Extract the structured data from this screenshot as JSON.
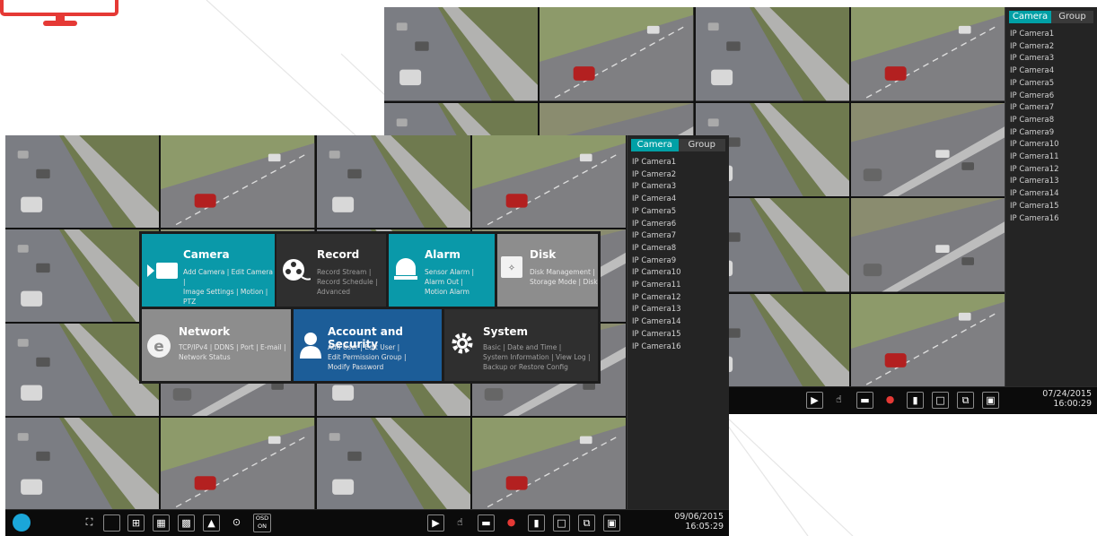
{
  "cameras": [
    "IP Camera1",
    "IP Camera2",
    "IP Camera3",
    "IP Camera4",
    "IP Camera5",
    "IP Camera6",
    "IP Camera7",
    "IP Camera8",
    "IP Camera9",
    "IP Camera10",
    "IP Camera11",
    "IP Camera12",
    "IP Camera13",
    "IP Camera14",
    "IP Camera15",
    "IP Camera16"
  ],
  "tabs": {
    "camera": "Camera",
    "group": "Group"
  },
  "back": {
    "date": "07/24/2015",
    "time": "16:00:29"
  },
  "front": {
    "date": "09/06/2015",
    "time": "16:05:29",
    "osd_line1": "OSD",
    "osd_line2": "ON"
  },
  "menu": {
    "camera": {
      "title": "Camera",
      "line1": "Add Camera | Edit Camera |",
      "line2": "Image Settings | Motion |",
      "line3": "PTZ"
    },
    "record": {
      "title": "Record",
      "line1": "Record Stream |",
      "line2": "Record Schedule |",
      "line3": "Advanced"
    },
    "alarm": {
      "title": "Alarm",
      "line1": "Sensor Alarm |",
      "line2": "Alarm Out |",
      "line3": "Motion Alarm"
    },
    "disk": {
      "title": "Disk",
      "line1": "Disk Management |",
      "line2": "Storage Mode | Disk"
    },
    "network": {
      "title": "Network",
      "line1": "TCP/IPv4 | DDNS | Port | E-mail |",
      "line2": "Network Status"
    },
    "account": {
      "title": "Account and Security",
      "line1": "Add User | Edit User |",
      "line2": "Edit Permission Group |",
      "line3": "Modify Password"
    },
    "system": {
      "title": "System",
      "line1": "Basic | Date and Time |",
      "line2": "System Information | View Log |",
      "line3": "Backup or Restore Config"
    }
  },
  "colors": {
    "teal": "#0097a7",
    "gray": "#8f8f8f",
    "dark": "#2f2f2f",
    "blue": "#1d5f9b",
    "accent_red": "#e53935"
  }
}
